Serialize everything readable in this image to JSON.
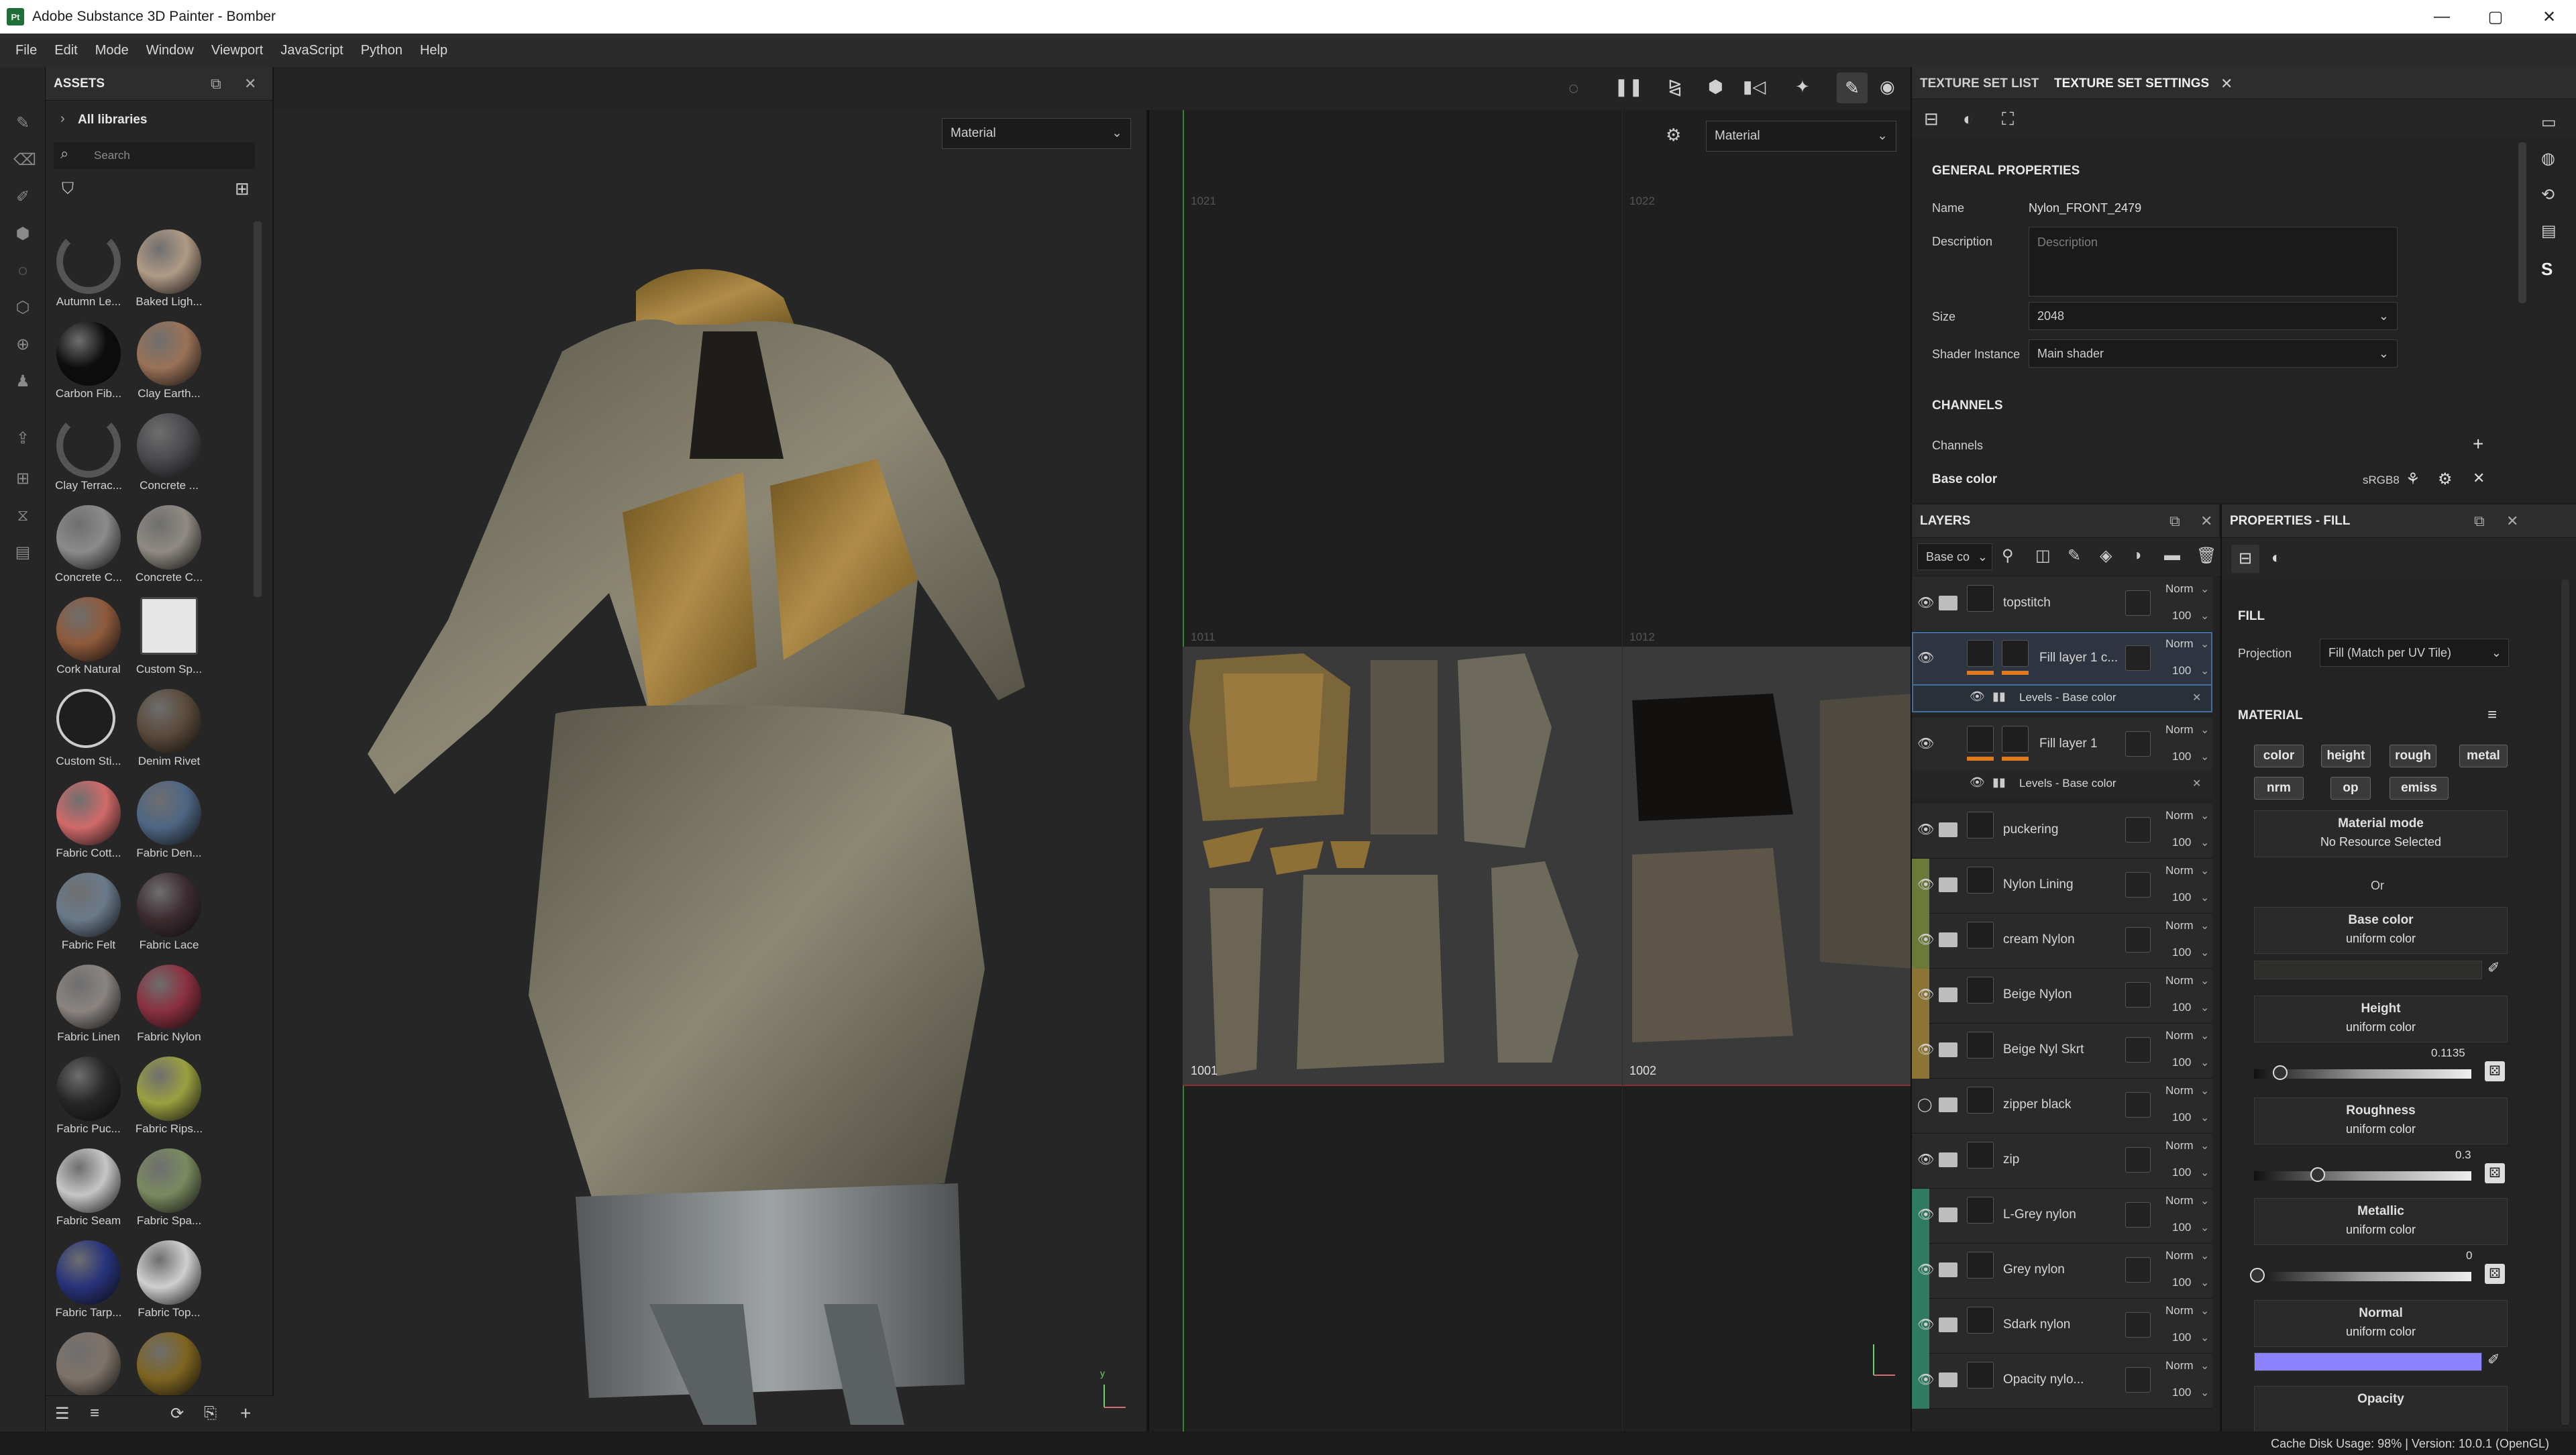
{
  "window": {
    "title": "Adobe Substance 3D Painter - Bomber",
    "logo_text": "Pt",
    "controls": {
      "minimize": "—",
      "maximize": "▢",
      "close": "✕"
    }
  },
  "menu": [
    "File",
    "Edit",
    "Mode",
    "Window",
    "Viewport",
    "JavaScript",
    "Python",
    "Help"
  ],
  "assets": {
    "title": "ASSETS",
    "all_libraries": "All libraries",
    "search_placeholder": "Search",
    "items": [
      {
        "label": "Autumn Le...",
        "color": "#555555",
        "type": "loading"
      },
      {
        "label": "Baked Ligh...",
        "color": "#b09a86"
      },
      {
        "label": "Carbon Fib...",
        "color": "#0d0d0d"
      },
      {
        "label": "Clay Earth...",
        "color": "#9a7257"
      },
      {
        "label": "Clay Terrac...",
        "color": "#555555",
        "type": "loading"
      },
      {
        "label": "Concrete ...",
        "color": "#4a4a4e"
      },
      {
        "label": "Concrete C...",
        "color": "#8b8b8b"
      },
      {
        "label": "Concrete C...",
        "color": "#8f8a82"
      },
      {
        "label": "Cork Natural",
        "color": "#8e5a3c"
      },
      {
        "label": "Custom Sp...",
        "color": "#cccccc",
        "type": "spray"
      },
      {
        "label": "Custom Sti...",
        "color": "#cccccc",
        "type": "sticker"
      },
      {
        "label": "Denim Rivet",
        "color": "#5a4a3a"
      },
      {
        "label": "Fabric Cott...",
        "color": "#d06a6a"
      },
      {
        "label": "Fabric Den...",
        "color": "#4e6684"
      },
      {
        "label": "Fabric Felt",
        "color": "#6a7a8a"
      },
      {
        "label": "Fabric Lace",
        "color": "#3c2c30"
      },
      {
        "label": "Fabric Linen",
        "color": "#8a8480"
      },
      {
        "label": "Fabric Nylon",
        "color": "#8a3040"
      },
      {
        "label": "Fabric Puc...",
        "color": "#262626"
      },
      {
        "label": "Fabric Rips...",
        "color": "#9aa040"
      },
      {
        "label": "Fabric Seam",
        "color": "#c6c6c6"
      },
      {
        "label": "Fabric Spa...",
        "color": "#7a8a60"
      },
      {
        "label": "Fabric Tarp...",
        "color": "#27337a"
      },
      {
        "label": "Fabric Top...",
        "color": "#cfcfcf"
      },
      {
        "label": "",
        "color": "#7e736a"
      },
      {
        "label": "",
        "color": "#7e6420"
      }
    ]
  },
  "viewport": {
    "mode_left": "Material",
    "mode_right": "Material",
    "udim_labels": {
      "t1": "1021",
      "t2": "1022",
      "m1": "1011",
      "m2": "1012",
      "b1": "1001",
      "b2": "1002"
    }
  },
  "texture_set": {
    "tab_list": "TEXTURE SET LIST",
    "tab_settings": "TEXTURE SET SETTINGS",
    "general_title": "GENERAL PROPERTIES",
    "name_label": "Name",
    "name_value": "Nylon_FRONT_2479",
    "description_label": "Description",
    "description_placeholder": "Description",
    "size_label": "Size",
    "size_value": "2048",
    "shader_label": "Shader Instance",
    "shader_value": "Main shader",
    "channels_title": "CHANNELS",
    "channels_label": "Channels",
    "base_color_label": "Base color",
    "base_color_format": "sRGB8"
  },
  "layers": {
    "title": "LAYERS",
    "channel_select": "Base co",
    "items": [
      {
        "name": "topstitch",
        "blend": "Norm",
        "opacity": "100",
        "color": "",
        "visible": true,
        "kind": "folder"
      },
      {
        "name": "Fill layer 1 c...",
        "blend": "Norm",
        "opacity": "100",
        "color": "",
        "visible": true,
        "kind": "fill",
        "selected": true,
        "sub": "Levels - Base color"
      },
      {
        "name": "Fill layer 1",
        "blend": "Norm",
        "opacity": "100",
        "color": "",
        "visible": true,
        "kind": "fill",
        "sub": "Levels - Base color"
      },
      {
        "name": "puckering",
        "blend": "Norm",
        "opacity": "100",
        "color": "",
        "visible": true,
        "kind": "folder"
      },
      {
        "name": "Nylon Lining",
        "blend": "Norm",
        "opacity": "100",
        "color": "#6b7a3a",
        "visible": true,
        "kind": "folder"
      },
      {
        "name": "cream Nylon",
        "blend": "Norm",
        "opacity": "100",
        "color": "#6b7a3a",
        "visible": true,
        "kind": "folder"
      },
      {
        "name": "Beige Nylon",
        "blend": "Norm",
        "opacity": "100",
        "color": "#8c7434",
        "visible": true,
        "kind": "folder"
      },
      {
        "name": "Beige Nyl Skrt",
        "blend": "Norm",
        "opacity": "100",
        "color": "#8c7434",
        "visible": true,
        "kind": "folder"
      },
      {
        "name": "zipper black",
        "blend": "Norm",
        "opacity": "100",
        "color": "",
        "visible": false,
        "kind": "folder"
      },
      {
        "name": "zip",
        "blend": "Norm",
        "opacity": "100",
        "color": "",
        "visible": true,
        "kind": "folder"
      },
      {
        "name": "L-Grey nylon",
        "blend": "Norm",
        "opacity": "100",
        "color": "#2f7a62",
        "visible": true,
        "kind": "folder"
      },
      {
        "name": "Grey nylon",
        "blend": "Norm",
        "opacity": "100",
        "color": "#2f7a62",
        "visible": true,
        "kind": "folder"
      },
      {
        "name": "Sdark nylon",
        "blend": "Norm",
        "opacity": "100",
        "color": "#2f7a62",
        "visible": true,
        "kind": "folder"
      },
      {
        "name": "Opacity nylo...",
        "blend": "Norm",
        "opacity": "100",
        "color": "#2f7a62",
        "visible": true,
        "kind": "folder"
      }
    ]
  },
  "properties": {
    "title": "PROPERTIES - FILL",
    "fill_title": "FILL",
    "projection_label": "Projection",
    "projection_value": "Fill (Match per UV Tile)",
    "material_title": "MATERIAL",
    "chips": [
      "color",
      "height",
      "rough",
      "metal",
      "nrm",
      "op",
      "emiss"
    ],
    "material_mode_label": "Material mode",
    "material_mode_value": "No Resource Selected",
    "or_text": "Or",
    "base_color_title": "Base color",
    "base_color_sub": "uniform color",
    "height_title": "Height",
    "height_sub": "uniform color",
    "height_value": "0.1135",
    "height_fraction": 0.1135,
    "roughness_title": "Roughness",
    "roughness_sub": "uniform color",
    "roughness_value": "0.3",
    "roughness_fraction": 0.3,
    "metallic_title": "Metallic",
    "metallic_sub": "uniform color",
    "metallic_value": "0",
    "metallic_fraction": 0,
    "normal_title": "Normal",
    "normal_sub": "uniform color",
    "normal_color": "#8c82ff",
    "opacity_title": "Opacity"
  },
  "status": {
    "text": "Cache Disk Usage:   98%  |  Version: 10.0.1 (OpenGL)"
  }
}
